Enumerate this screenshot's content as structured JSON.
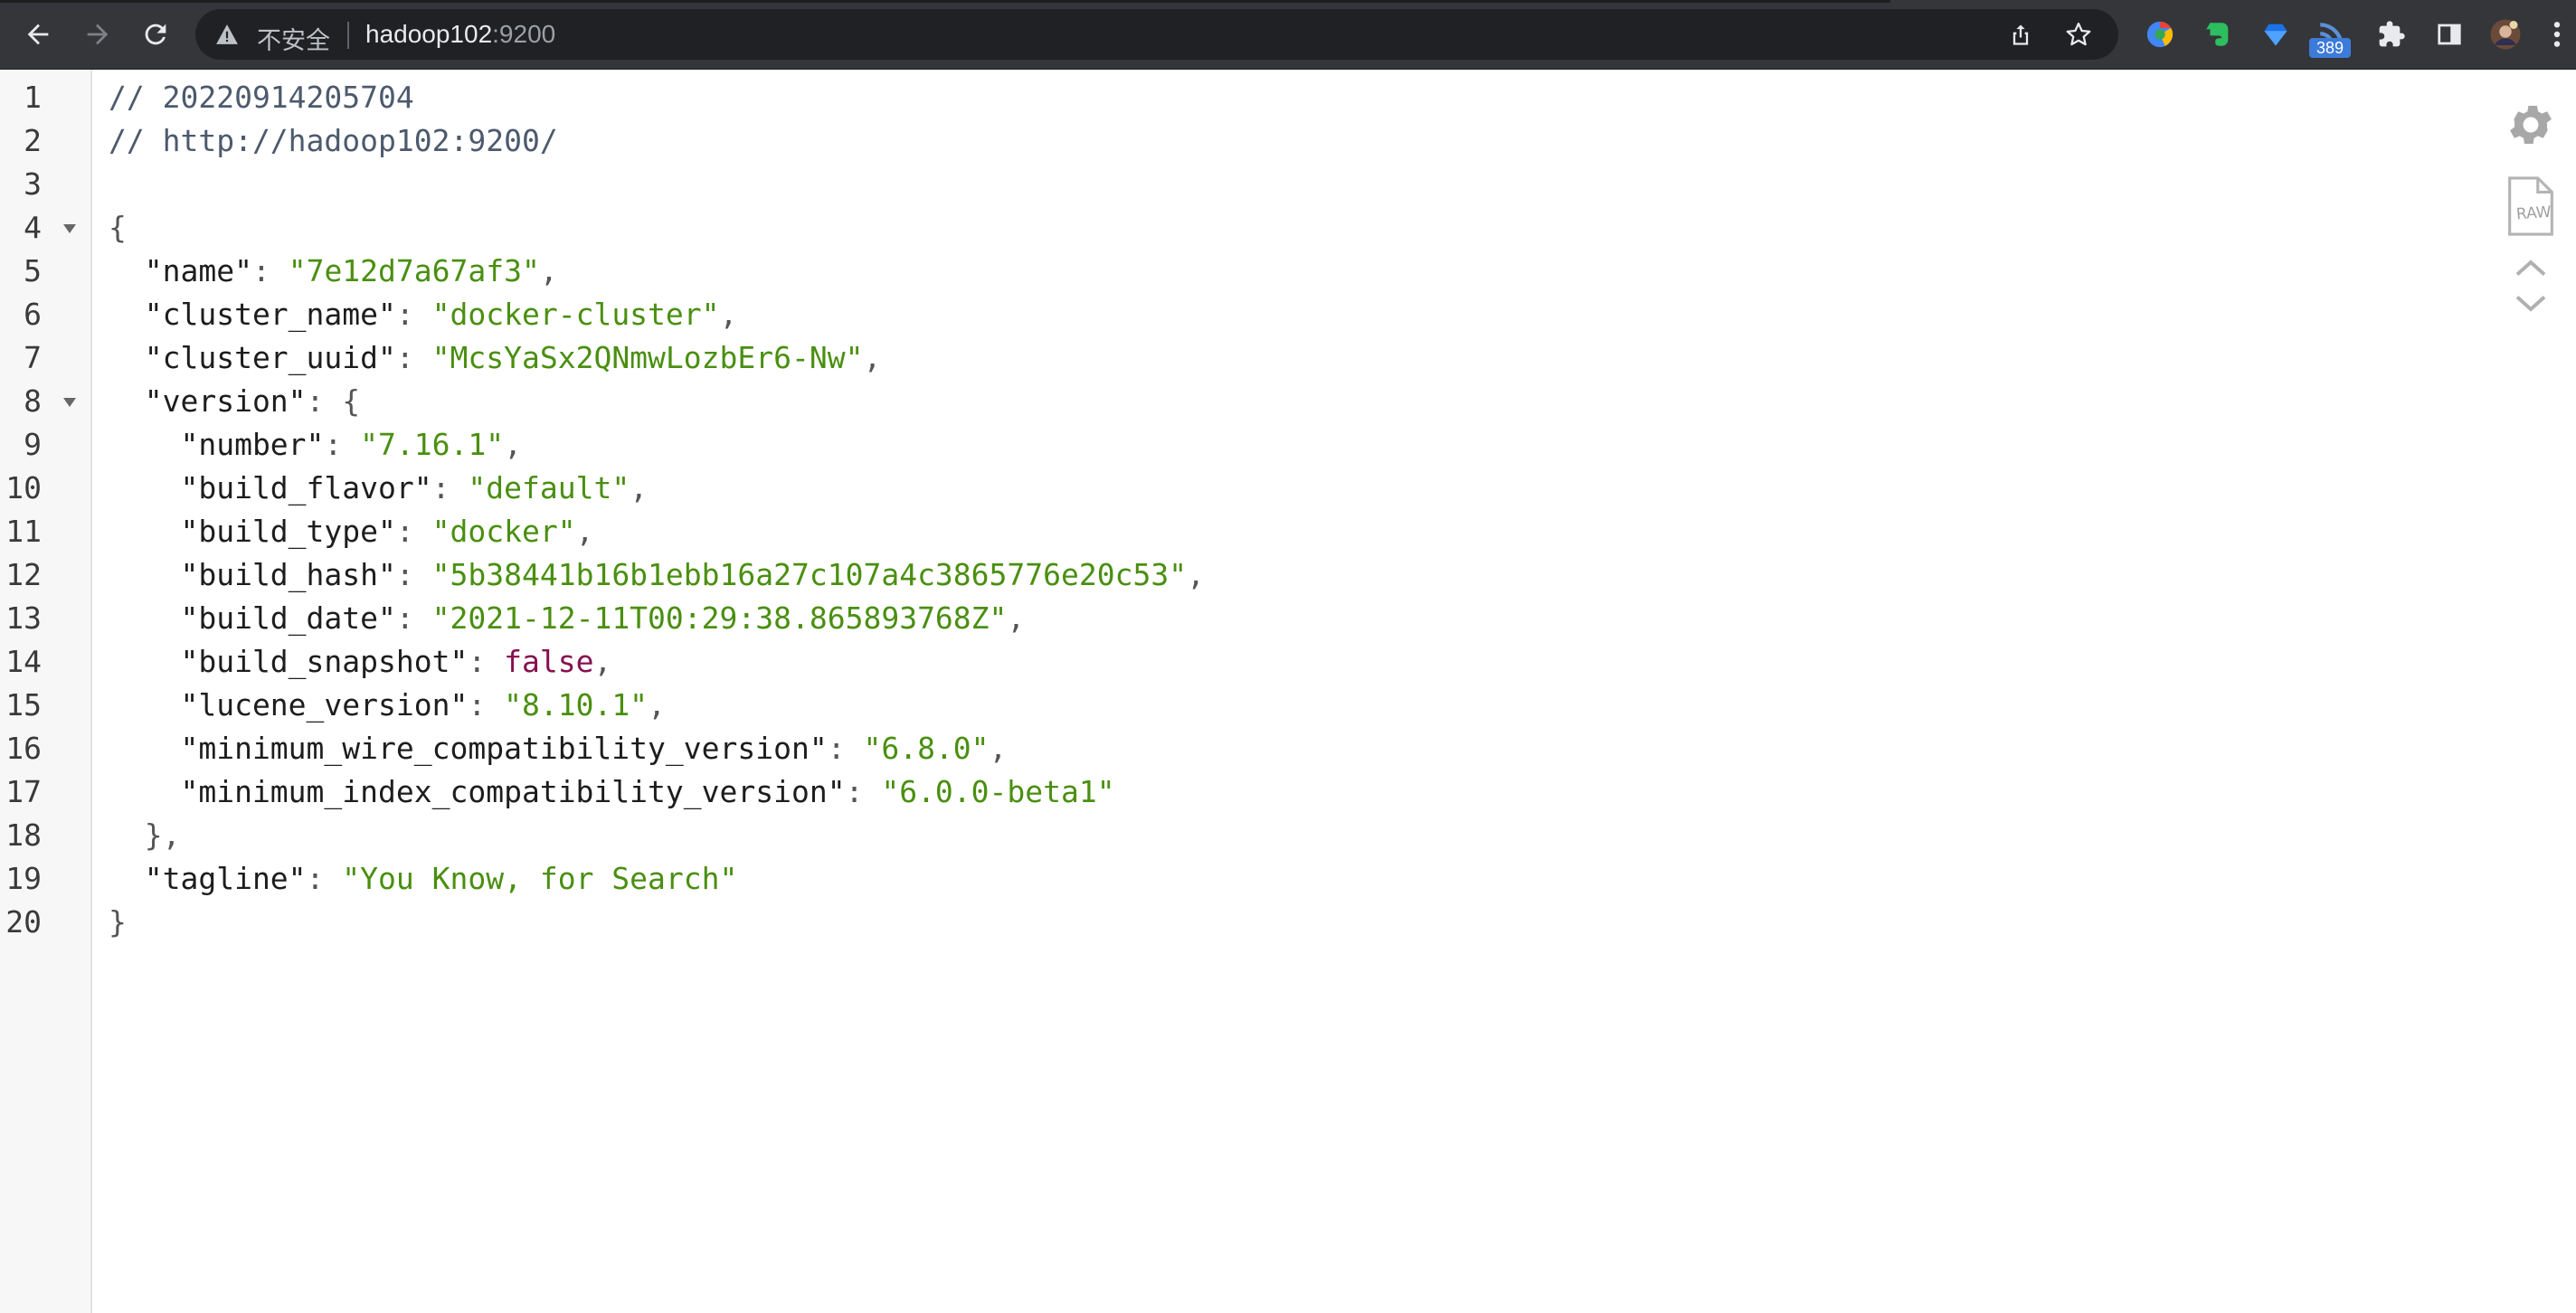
{
  "browser": {
    "security_label": "不安全",
    "url_host": "hadoop102",
    "url_port": ":9200",
    "extension_badge": "389"
  },
  "viewer": {
    "settings_icon": "gear-icon",
    "raw_label": "RAW",
    "lines": [
      {
        "n": "1",
        "parts": [
          {
            "t": "// 20220914205704",
            "c": "comment"
          }
        ]
      },
      {
        "n": "2",
        "parts": [
          {
            "t": "// http://hadoop102:9200/",
            "c": "comment"
          }
        ]
      },
      {
        "n": "3",
        "parts": []
      },
      {
        "n": "4",
        "fold": true,
        "parts": [
          {
            "t": "{",
            "c": "punct"
          }
        ]
      },
      {
        "n": "5",
        "parts": [
          {
            "t": "  \"name\"",
            "c": "key"
          },
          {
            "t": ": ",
            "c": "punct"
          },
          {
            "t": "\"7e12d7a67af3\"",
            "c": "str"
          },
          {
            "t": ",",
            "c": "punct"
          }
        ]
      },
      {
        "n": "6",
        "parts": [
          {
            "t": "  \"cluster_name\"",
            "c": "key"
          },
          {
            "t": ": ",
            "c": "punct"
          },
          {
            "t": "\"docker-cluster\"",
            "c": "str"
          },
          {
            "t": ",",
            "c": "punct"
          }
        ]
      },
      {
        "n": "7",
        "parts": [
          {
            "t": "  \"cluster_uuid\"",
            "c": "key"
          },
          {
            "t": ": ",
            "c": "punct"
          },
          {
            "t": "\"McsYaSx2QNmwLozbEr6-Nw\"",
            "c": "str"
          },
          {
            "t": ",",
            "c": "punct"
          }
        ]
      },
      {
        "n": "8",
        "fold": true,
        "parts": [
          {
            "t": "  \"version\"",
            "c": "key"
          },
          {
            "t": ": {",
            "c": "punct"
          }
        ]
      },
      {
        "n": "9",
        "parts": [
          {
            "t": "    \"number\"",
            "c": "key"
          },
          {
            "t": ": ",
            "c": "punct"
          },
          {
            "t": "\"7.16.1\"",
            "c": "str"
          },
          {
            "t": ",",
            "c": "punct"
          }
        ]
      },
      {
        "n": "10",
        "parts": [
          {
            "t": "    \"build_flavor\"",
            "c": "key"
          },
          {
            "t": ": ",
            "c": "punct"
          },
          {
            "t": "\"default\"",
            "c": "str"
          },
          {
            "t": ",",
            "c": "punct"
          }
        ]
      },
      {
        "n": "11",
        "parts": [
          {
            "t": "    \"build_type\"",
            "c": "key"
          },
          {
            "t": ": ",
            "c": "punct"
          },
          {
            "t": "\"docker\"",
            "c": "str"
          },
          {
            "t": ",",
            "c": "punct"
          }
        ]
      },
      {
        "n": "12",
        "parts": [
          {
            "t": "    \"build_hash\"",
            "c": "key"
          },
          {
            "t": ": ",
            "c": "punct"
          },
          {
            "t": "\"5b38441b16b1ebb16a27c107a4c3865776e20c53\"",
            "c": "str"
          },
          {
            "t": ",",
            "c": "punct"
          }
        ]
      },
      {
        "n": "13",
        "parts": [
          {
            "t": "    \"build_date\"",
            "c": "key"
          },
          {
            "t": ": ",
            "c": "punct"
          },
          {
            "t": "\"2021-12-11T00:29:38.865893768Z\"",
            "c": "str"
          },
          {
            "t": ",",
            "c": "punct"
          }
        ]
      },
      {
        "n": "14",
        "parts": [
          {
            "t": "    \"build_snapshot\"",
            "c": "key"
          },
          {
            "t": ": ",
            "c": "punct"
          },
          {
            "t": "false",
            "c": "bool"
          },
          {
            "t": ",",
            "c": "punct"
          }
        ]
      },
      {
        "n": "15",
        "parts": [
          {
            "t": "    \"lucene_version\"",
            "c": "key"
          },
          {
            "t": ": ",
            "c": "punct"
          },
          {
            "t": "\"8.10.1\"",
            "c": "str"
          },
          {
            "t": ",",
            "c": "punct"
          }
        ]
      },
      {
        "n": "16",
        "parts": [
          {
            "t": "    \"minimum_wire_compatibility_version\"",
            "c": "key"
          },
          {
            "t": ": ",
            "c": "punct"
          },
          {
            "t": "\"6.8.0\"",
            "c": "str"
          },
          {
            "t": ",",
            "c": "punct"
          }
        ]
      },
      {
        "n": "17",
        "parts": [
          {
            "t": "    \"minimum_index_compatibility_version\"",
            "c": "key"
          },
          {
            "t": ": ",
            "c": "punct"
          },
          {
            "t": "\"6.0.0-beta1\"",
            "c": "str"
          }
        ]
      },
      {
        "n": "18",
        "parts": [
          {
            "t": "  },",
            "c": "punct"
          }
        ]
      },
      {
        "n": "19",
        "parts": [
          {
            "t": "  \"tagline\"",
            "c": "key"
          },
          {
            "t": ": ",
            "c": "punct"
          },
          {
            "t": "\"You Know, for Search\"",
            "c": "str"
          }
        ]
      },
      {
        "n": "20",
        "parts": [
          {
            "t": "}",
            "c": "punct"
          }
        ]
      }
    ]
  },
  "colors": {
    "toolbar_bg": "#35363a",
    "omnibox_bg": "#202124",
    "string": "#4a8f10",
    "boolean": "#871050",
    "comment": "#4d5a6d"
  }
}
